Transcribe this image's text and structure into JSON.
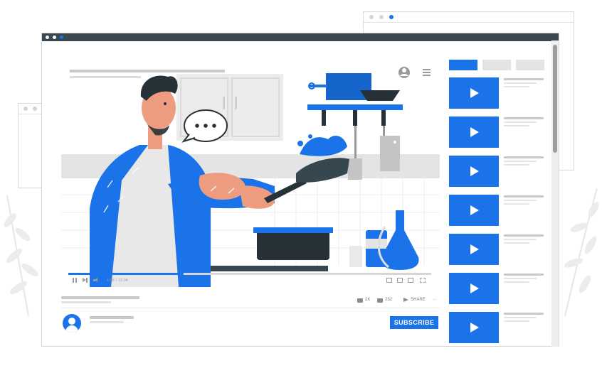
{
  "window": {
    "traffic_lights": [
      "#ffffff",
      "#ffffff",
      "#1a73e8"
    ]
  },
  "player": {
    "time_display": "4:08 / 12:04",
    "progress_fraction": 0.31,
    "speech_bubble_text": "•••"
  },
  "actions": {
    "likes": "2K",
    "dislikes": "232",
    "share_label": "SHARE",
    "more_label": "···"
  },
  "channel": {
    "subscribe_label": "SUBSCRIBE"
  },
  "sidebar": {
    "video_count": 7
  },
  "colors": {
    "accent": "#1a73e8",
    "titlebar": "#3a4750",
    "chef_skin": "#ee9c80",
    "pan": "#263238"
  },
  "icons": [
    "play-icon",
    "pause-icon",
    "next-icon",
    "volume-icon",
    "like-icon",
    "dislike-icon",
    "share-icon",
    "avatar-icon",
    "menu-icon",
    "settings-icon",
    "fullscreen-icon"
  ]
}
